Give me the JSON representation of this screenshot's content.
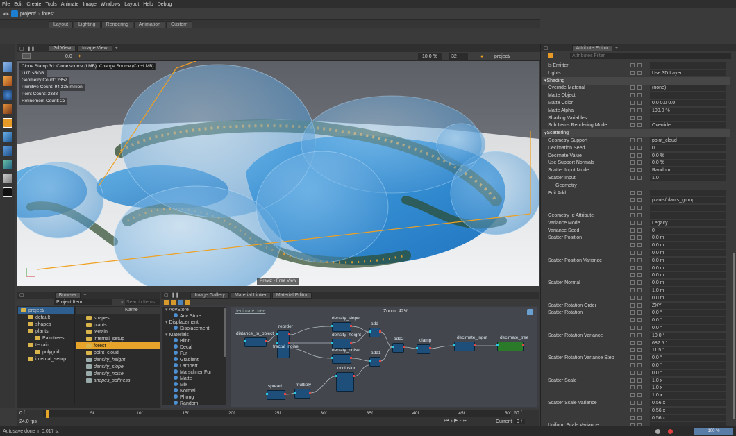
{
  "menu": [
    "File",
    "Edit",
    "Create",
    "Tools",
    "Animate",
    "Image",
    "Windows",
    "Layout",
    "Help",
    "Debug"
  ],
  "project": {
    "path": "project/",
    "current": "forest"
  },
  "workspace_tabs": [
    "Layout",
    "Lighting",
    "Rendering",
    "Animation",
    "Custom"
  ],
  "viewport": {
    "tabs": [
      "3d View",
      "Image View"
    ],
    "zoom": "10.0 %",
    "samples": "32",
    "camera_path": "project/",
    "frame_value": "0.0",
    "hud": {
      "tool": "Clone Stamp 3d: Clone source (LMB)",
      "tool_alt": "Change Source (Ctrl+LMB)",
      "lut": "LUT: sRGB",
      "geometry": "Geometry Count: 2352",
      "primitive": "Primitive Count: 94.335 million",
      "point": "Point Count: 2338",
      "refinement": "Refinement Count: 23"
    },
    "caption": "Previz - Free View"
  },
  "browser": {
    "tab": "Browser",
    "project_item": "Project Item",
    "search_placeholder": "Search Items",
    "col_name": "Name",
    "tree": [
      {
        "label": "project/",
        "level": 0
      },
      {
        "label": "default",
        "level": 1
      },
      {
        "label": "shapes",
        "level": 1
      },
      {
        "label": "plants",
        "level": 1
      },
      {
        "label": "Palmtrees",
        "level": 2
      },
      {
        "label": "terrain",
        "level": 1
      },
      {
        "label": "polygrid",
        "level": 2
      },
      {
        "label": "internal_setup",
        "level": 1
      }
    ],
    "items": [
      {
        "label": "shapes",
        "italic": false,
        "selected": false
      },
      {
        "label": "plants",
        "italic": false,
        "selected": false
      },
      {
        "label": "terrain",
        "italic": false,
        "selected": false
      },
      {
        "label": "internal_setup",
        "italic": false,
        "selected": false
      },
      {
        "label": "forest",
        "italic": false,
        "selected": true
      },
      {
        "label": "point_cloud",
        "italic": false,
        "selected": false
      },
      {
        "label": "density_height",
        "italic": true,
        "selected": false
      },
      {
        "label": "density_slope",
        "italic": true,
        "selected": false
      },
      {
        "label": "density_noise",
        "italic": true,
        "selected": false
      },
      {
        "label": "shapes_softness",
        "italic": true,
        "selected": false
      }
    ]
  },
  "material_editor": {
    "tabs": [
      "Image Gallery",
      "Material Linker",
      "Material Editor"
    ],
    "title": "decimate_tree",
    "zoom": "Zoom: 42%",
    "library": [
      {
        "label": "AovStore",
        "header": true
      },
      {
        "label": "Aov Store",
        "header": false
      },
      {
        "label": "Displacement",
        "header": true
      },
      {
        "label": "Displacement",
        "header": false
      },
      {
        "label": "Materials",
        "header": true
      },
      {
        "label": "Blinn",
        "header": false
      },
      {
        "label": "Decal",
        "header": false
      },
      {
        "label": "Fur",
        "header": false
      },
      {
        "label": "Gradient",
        "header": false
      },
      {
        "label": "Lambert",
        "header": false
      },
      {
        "label": "Marschner Fur",
        "header": false
      },
      {
        "label": "Matte",
        "header": false
      },
      {
        "label": "Mix",
        "header": false
      },
      {
        "label": "Normal",
        "header": false
      },
      {
        "label": "Phong",
        "header": false
      },
      {
        "label": "Random",
        "header": false
      }
    ],
    "nodes": [
      "distance_to_object",
      "reorder",
      "fractal_noise",
      "density_slope",
      "density_height",
      "density_noise",
      "add",
      "add1",
      "add2",
      "clamp",
      "decimate_input",
      "decimate_tree",
      "occlusion",
      "spread",
      "multiply"
    ]
  },
  "attribute_editor": {
    "tab": "Attribute Editor",
    "filter_placeholder": "Attributes Filter",
    "rows": [
      {
        "type": "row",
        "label": "Is Emitter",
        "value": ""
      },
      {
        "type": "row",
        "label": "Lights",
        "value": "Use 3D Layer"
      },
      {
        "type": "section",
        "label": "Shading"
      },
      {
        "type": "row",
        "label": "Override Material",
        "value": "(none)"
      },
      {
        "type": "row",
        "label": "Matte Object",
        "value": ""
      },
      {
        "type": "row",
        "label": "Matte Color",
        "value": "0.0     0.0     0.0"
      },
      {
        "type": "row",
        "label": "Matte Alpha",
        "value": "100.0 %"
      },
      {
        "type": "row",
        "label": "Shading Variables",
        "value": ""
      },
      {
        "type": "row",
        "label": "Sub Items Rendering Mode",
        "value": "Override"
      },
      {
        "type": "section",
        "label": "Scattering"
      },
      {
        "type": "row",
        "label": "Geometry Support",
        "value": "point_cloud"
      },
      {
        "type": "row",
        "label": "Decimation Seed",
        "value": "0"
      },
      {
        "type": "row",
        "label": "Decimate Value",
        "value": "0.0 %"
      },
      {
        "type": "row",
        "label": "Use Support Normals",
        "value": "0.0 %"
      },
      {
        "type": "row",
        "label": "Scatter Input Mode",
        "value": "Random"
      },
      {
        "type": "row",
        "label": "Scatter Input",
        "value": "1.0"
      },
      {
        "type": "sub",
        "label": "Geometry"
      },
      {
        "type": "row",
        "label": "Edit   Add...",
        "value": ""
      },
      {
        "type": "row",
        "label": "",
        "value": "plants/plants_group"
      },
      {
        "type": "row",
        "label": "",
        "value": ""
      },
      {
        "type": "row",
        "label": "Geometry Id Attribute",
        "value": ""
      },
      {
        "type": "row",
        "label": "Variance Mode",
        "value": "Legacy"
      },
      {
        "type": "row",
        "label": "Variance Seed",
        "value": "0"
      },
      {
        "type": "row",
        "label": "Scatter Position",
        "value": "0.0 m"
      },
      {
        "type": "row",
        "label": "",
        "value": "0.0 m"
      },
      {
        "type": "row",
        "label": "",
        "value": "0.0 m"
      },
      {
        "type": "row",
        "label": "Scatter Position Variance",
        "value": "0.0 m"
      },
      {
        "type": "row",
        "label": "",
        "value": "0.0 m"
      },
      {
        "type": "row",
        "label": "",
        "value": "0.0 m"
      },
      {
        "type": "row",
        "label": "Scatter Normal",
        "value": "0.0 m"
      },
      {
        "type": "row",
        "label": "",
        "value": "1.0 m"
      },
      {
        "type": "row",
        "label": "",
        "value": "0.0 m"
      },
      {
        "type": "row",
        "label": "Scatter Rotation Order",
        "value": "ZXY"
      },
      {
        "type": "row",
        "label": "Scatter Rotation",
        "value": "0.0 °"
      },
      {
        "type": "row",
        "label": "",
        "value": "0.0 °"
      },
      {
        "type": "row",
        "label": "",
        "value": "0.0 °"
      },
      {
        "type": "row",
        "label": "Scatter Rotation Variance",
        "value": "10.0 °"
      },
      {
        "type": "row",
        "label": "",
        "value": "682.5 °"
      },
      {
        "type": "row",
        "label": "",
        "value": "11.5 °"
      },
      {
        "type": "row",
        "label": "Scatter Rotation Variance Step",
        "value": "0.0 °"
      },
      {
        "type": "row",
        "label": "",
        "value": "0.0 °"
      },
      {
        "type": "row",
        "label": "",
        "value": "0.0 °"
      },
      {
        "type": "row",
        "label": "Scatter Scale",
        "value": "1.0 x"
      },
      {
        "type": "row",
        "label": "",
        "value": "1.0 x"
      },
      {
        "type": "row",
        "label": "",
        "value": "1.0 x"
      },
      {
        "type": "row",
        "label": "Scatter Scale Variance",
        "value": "0.56 x"
      },
      {
        "type": "row",
        "label": "",
        "value": "0.56 x"
      },
      {
        "type": "row",
        "label": "",
        "value": "0.56 x"
      },
      {
        "type": "row",
        "label": "Uniform Scale Variance",
        "value": ""
      }
    ]
  },
  "timeline": {
    "start": "0 f",
    "fps": "24.0 fps",
    "ticks": [
      "5f",
      "10f",
      "15f",
      "20f",
      "25f",
      "30f",
      "35f",
      "40f",
      "45f",
      "50f"
    ],
    "end": "50 f",
    "current_label": "Current",
    "current": "0 f"
  },
  "status": {
    "message": "Autosave done in 0.017 s.",
    "meter": "100 %"
  },
  "colors": {
    "accent_orange": "#f0a020",
    "node_blue": "#1e4f7a",
    "node_green": "#2a7a2a",
    "select_blue": "#2f6fad"
  }
}
